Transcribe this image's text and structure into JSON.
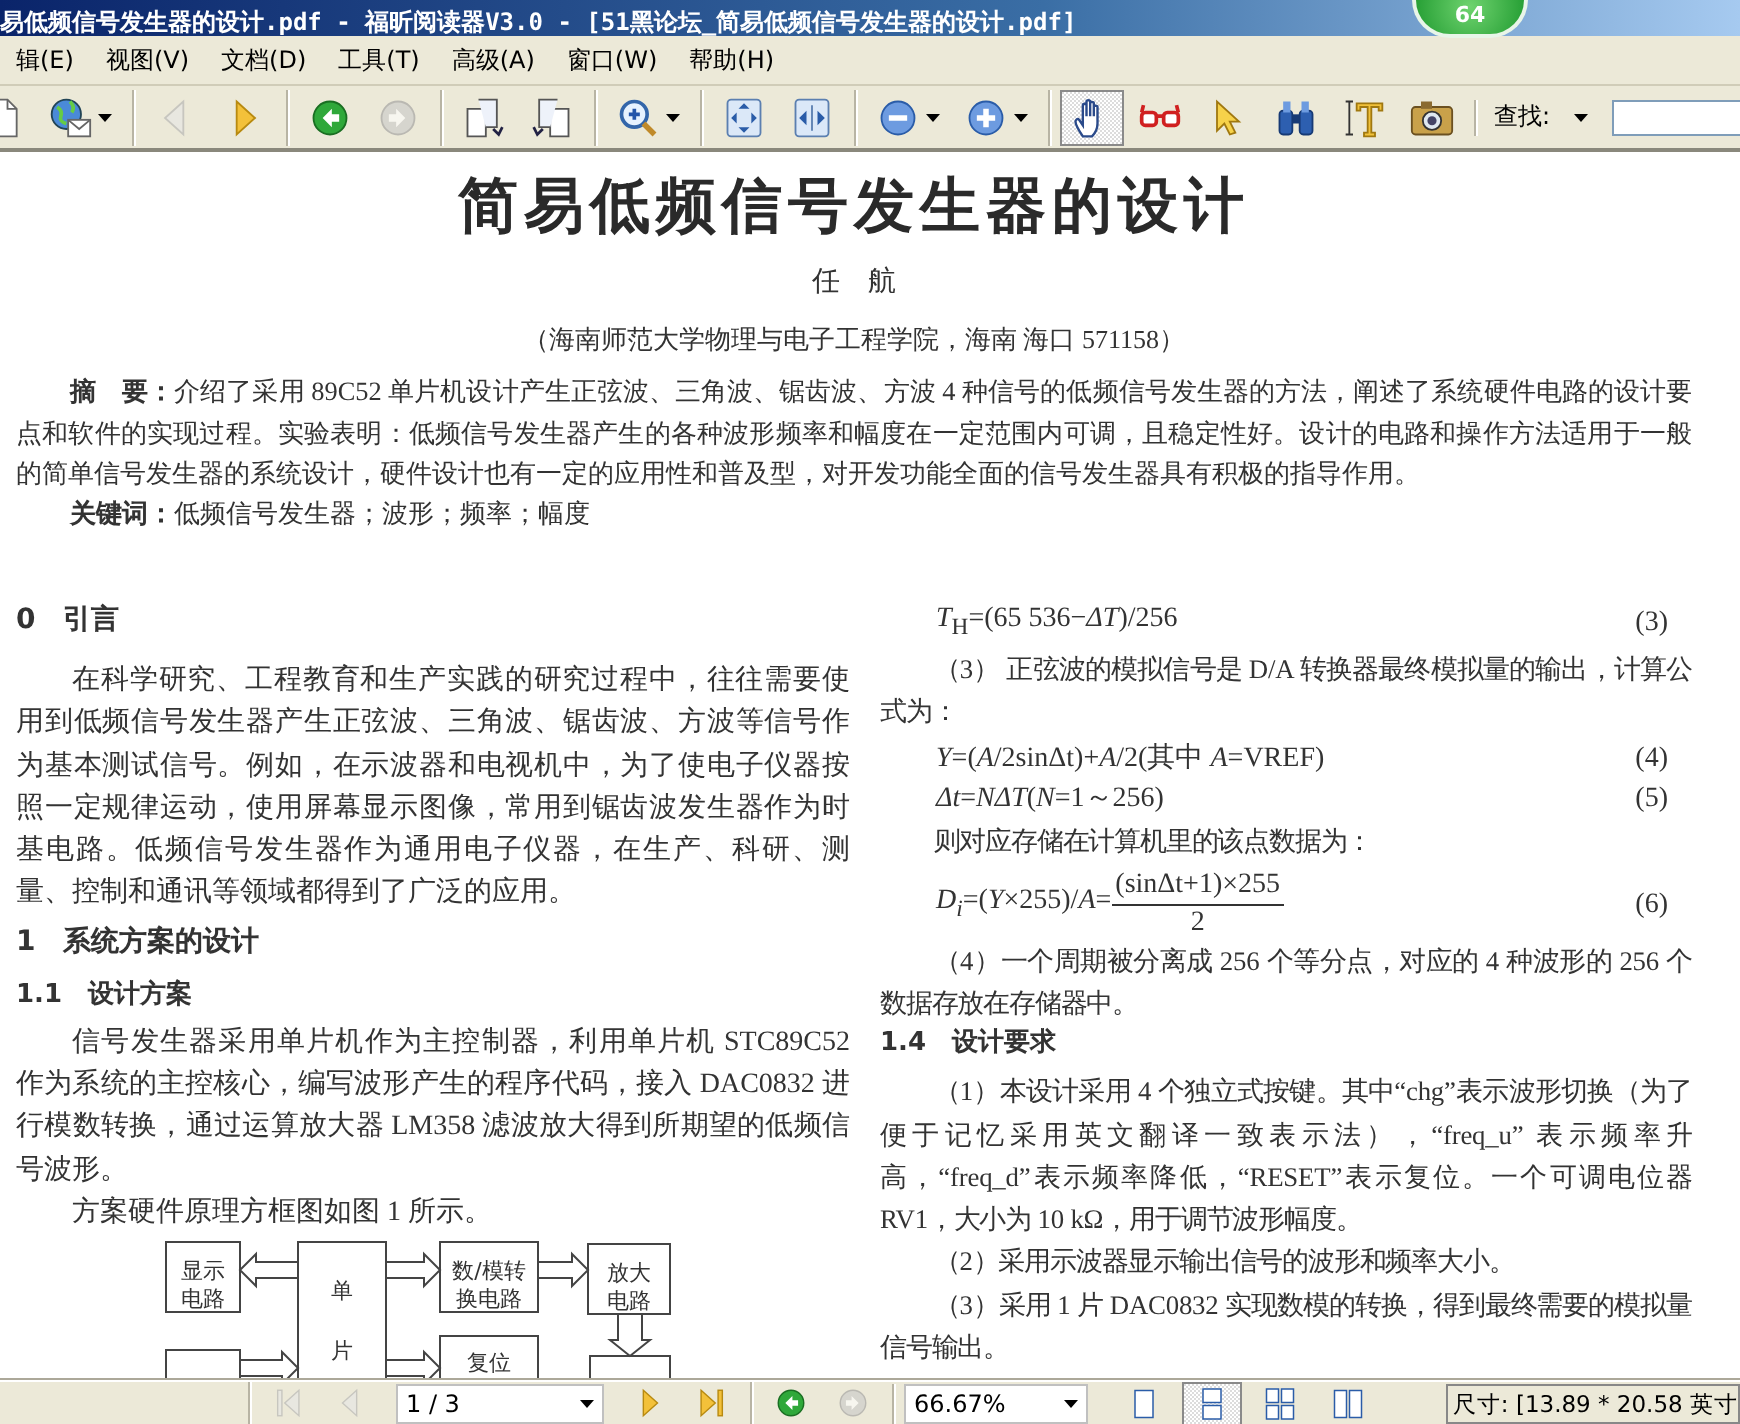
{
  "window": {
    "title": "易低频信号发生器的设计.pdf - 福昕阅读器V3.0 - [51黑论坛_简易低频信号发生器的设计.pdf]"
  },
  "badge": "64",
  "menu": [
    "辑(E)",
    "视图(V)",
    "文档(D)",
    "工具(T)",
    "高级(A)",
    "窗口(W)",
    "帮助(H)"
  ],
  "toolbar": {
    "groups": [
      {
        "tools": [
          {
            "kind": "document",
            "disabled": false,
            "selected": false,
            "dropdown": false
          },
          {
            "kind": "globe-mail",
            "disabled": false,
            "selected": false,
            "dropdown": true
          }
        ]
      },
      {
        "tools": [
          {
            "kind": "previous-page",
            "disabled": true,
            "selected": false,
            "dropdown": false
          },
          {
            "kind": "next-page",
            "disabled": false,
            "selected": false,
            "dropdown": false
          }
        ]
      },
      {
        "tools": [
          {
            "kind": "back",
            "disabled": false,
            "selected": false,
            "dropdown": false
          },
          {
            "kind": "forward",
            "disabled": true,
            "selected": false,
            "dropdown": false
          }
        ]
      },
      {
        "tools": [
          {
            "kind": "rotate-left",
            "disabled": false,
            "selected": false,
            "dropdown": false
          },
          {
            "kind": "rotate-right",
            "disabled": false,
            "selected": false,
            "dropdown": false
          }
        ]
      },
      {
        "tools": [
          {
            "kind": "zoom-tool",
            "disabled": false,
            "selected": false,
            "dropdown": true
          }
        ]
      },
      {
        "tools": [
          {
            "kind": "fit-page",
            "disabled": false,
            "selected": false,
            "dropdown": false
          },
          {
            "kind": "fit-width",
            "disabled": false,
            "selected": false,
            "dropdown": false
          }
        ]
      },
      {
        "tools": [
          {
            "kind": "zoom-out",
            "disabled": false,
            "selected": false,
            "dropdown": true
          },
          {
            "kind": "zoom-in",
            "disabled": false,
            "selected": false,
            "dropdown": true
          }
        ]
      },
      {
        "tools": [
          {
            "kind": "hand",
            "disabled": false,
            "selected": true,
            "dropdown": false
          },
          {
            "kind": "glasses",
            "disabled": false,
            "selected": false,
            "dropdown": false
          },
          {
            "kind": "select",
            "disabled": false,
            "selected": false,
            "dropdown": false
          },
          {
            "kind": "find",
            "disabled": false,
            "selected": false,
            "dropdown": false
          },
          {
            "kind": "text-select",
            "disabled": false,
            "selected": false,
            "dropdown": false
          },
          {
            "kind": "snapshot",
            "disabled": false,
            "selected": false,
            "dropdown": false
          }
        ]
      }
    ],
    "find_label": "查找:"
  },
  "document": {
    "title": "简易低频信号发生器的设计",
    "author": "任　航",
    "affiliation": "（海南师范大学物理与电子工程学院，海南 海口 571158）",
    "abstract": {
      "label": "摘　要：",
      "text": "介绍了采用 89C52 单片机设计产生正弦波、三角波、锯齿波、方波 4 种信号的低频信号发生器的方法，阐述了系统硬件电路的设计要点和软件的实现过程。实验表明：低频信号发生器产生的各种波形频率和幅度在一定范围内可调，且稳定性好。设计的电路和操作方法适用于一般的简单信号发生器的系统设计，硬件设计也有一定的应用性和普及型，对开发功能全面的信号发生器具有积极的指导作用。"
    },
    "keywords": {
      "label": "关键词：",
      "text": "低频信号发生器；波形；频率；幅度"
    },
    "left_column": [
      {
        "kind": "heading",
        "text": "0　引言"
      },
      {
        "kind": "paragraph",
        "text": "在科学研究、工程教育和生产实践的研究过程中，往往需要使用到低频信号发生器产生正弦波、三角波、锯齿波、方波等信号作为基本测试信号。例如，在示波器和电视机中，为了使电子仪器按照一定规律运动，使用屏幕显示图像，常用到锯齿波发生器作为时基电路。低频信号发生器作为通用电子仪器，在生产、科研、测量、控制和通讯等领域都得到了广泛的应用。"
      },
      {
        "kind": "heading",
        "text": "1　系统方案的设计"
      },
      {
        "kind": "subheading",
        "text": "1.1　设计方案"
      },
      {
        "kind": "paragraph",
        "text": "信号发生器采用单片机作为主控制器，利用单片机 STC89C52 作为系统的主控核心，编写波形产生的程序代码，接入 DAC0832 进行模数转换，通过运算放大器 LM358 滤波放大得到所期望的低频信号波形。"
      },
      {
        "kind": "paragraph",
        "text": "方案硬件原理方框图如图 1 所示。"
      },
      {
        "kind": "diagram",
        "labels": [
          {
            "lines": [
              "显示",
              "电路"
            ]
          },
          {
            "lines": [
              "单",
              "片"
            ]
          },
          {
            "lines": [
              "数/模转",
              "换电路"
            ]
          },
          {
            "lines": [
              "放大",
              "电路"
            ]
          },
          {
            "lines": [
              "复位"
            ]
          }
        ]
      }
    ],
    "right_column": [
      {
        "kind": "equation",
        "text": "*T*$_{H}$=(65 536−*ΔT*)/256",
        "number": "(3)"
      },
      {
        "kind": "paragraph",
        "text": "（3） 正弦波的模拟信号是 D/A 转换器最终模拟量的输出，计算公式为："
      },
      {
        "kind": "equation",
        "text": "*Y*=(*A*/2sinΔt)+*A*/2(其中 *A*=VREF)",
        "number": "(4)"
      },
      {
        "kind": "equation",
        "text": "*Δt*=*NΔT*(*N*=1～256)",
        "number": "(5)"
      },
      {
        "kind": "paragraph",
        "text": "则对应存储在计算机里的该点数据为："
      },
      {
        "kind": "fraction",
        "text": "*D$_{i}$*=(*Y*×255)/*A*=",
        "numerator": "(sinΔt+1)×255",
        "denominator": "2",
        "number": "(6)"
      },
      {
        "kind": "paragraph",
        "text": "（4）一个周期被分离成 256 个等分点，对应的 4 种波形的 256 个数据存放在存储器中。"
      },
      {
        "kind": "subheading",
        "text": "1.4　设计要求"
      },
      {
        "kind": "paragraph",
        "text": "（1）本设计采用 4 个独立式按键。其中“chg”表示波形切换（为了便于记忆采用英文翻译一致表示法），“freq_u” 表示频率升高，“freq_d”表示频率降低，“RESET”表示复位。一个可调电位器 RV1，大小为 10 kΩ，用于调节波形幅度。"
      },
      {
        "kind": "paragraph",
        "text": "（2）采用示波器显示输出信号的波形和频率大小。"
      },
      {
        "kind": "paragraph",
        "text": "（3）采用 1 片 DAC0832 实现数模的转换，得到最终需要的模拟量信号输出。"
      }
    ]
  },
  "status_bar": {
    "nav_back": [
      {
        "kind": "first-page",
        "disabled": true
      },
      {
        "kind": "previous-page",
        "disabled": true
      }
    ],
    "page_field": "1 / 3",
    "nav_forward": [
      {
        "kind": "next-page",
        "disabled": false
      },
      {
        "kind": "last-page",
        "disabled": false
      }
    ],
    "history": [
      {
        "kind": "back",
        "disabled": false
      },
      {
        "kind": "forward",
        "disabled": true
      }
    ],
    "zoom_field": "66.67%",
    "layouts": [
      {
        "kind": "single",
        "selected": false
      },
      {
        "kind": "continuous",
        "selected": true
      },
      {
        "kind": "facing",
        "selected": false
      },
      {
        "kind": "continuous-facing",
        "selected": false
      }
    ],
    "page_size": "尺寸: [13.89 * 20.58 英寸"
  }
}
